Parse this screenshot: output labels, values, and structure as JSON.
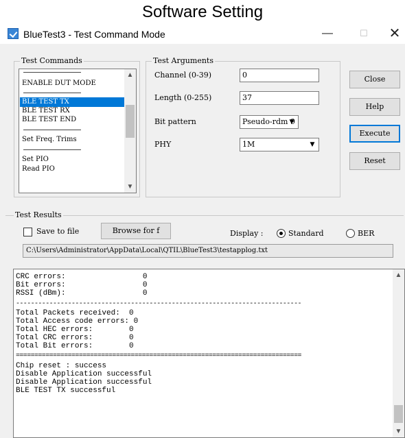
{
  "caption": "Software Setting",
  "window": {
    "title": "BlueTest3 - Test Command Mode",
    "min_glyph": "—",
    "max_glyph": "☐",
    "close_glyph": "✕"
  },
  "test_commands": {
    "legend": "Test Commands",
    "items": [
      "ENABLE DUT MODE",
      "BLE TEST TX",
      "BLE TEST RX",
      "BLE TEST END",
      "Set Freq. Trims",
      "Set PIO",
      "Read PIO"
    ],
    "selected": "BLE TEST TX"
  },
  "test_arguments": {
    "legend": "Test Arguments",
    "channel_label": "Channel (0-39)",
    "channel_value": "0",
    "length_label": "Length (0-255)",
    "length_value": "37",
    "bit_pattern_label": "Bit pattern",
    "bit_pattern_value": "Pseudo-rdm 9",
    "phy_label": "PHY",
    "phy_value": "1M"
  },
  "buttons": {
    "close": "Close",
    "help": "Help",
    "execute": "Execute",
    "reset": "Reset"
  },
  "test_results": {
    "legend": "Test Results",
    "save_to_file_label": "Save to file",
    "save_to_file_checked": false,
    "browse_label": "Browse for f",
    "display_label": "Display :",
    "display_options": [
      "Standard",
      "BER"
    ],
    "display_selected": "Standard",
    "log_path": "C:\\Users\\Administrator\\AppData\\Local\\QTIL\\BlueTest3\\testapplog.txt"
  },
  "log_lines": [
    "CRC errors:                 0",
    "Bit errors:                 0",
    "RSSI (dBm):                 0",
    "-----------------------------------------------------------------------------",
    "Total Packets received:  0",
    "Total Access code errors: 0",
    "Total HEC errors:        0",
    "Total CRC errors:        0",
    "Total Bit errors:        0",
    "=============================================================================",
    "Chip reset : success",
    "Disable Application successful",
    "Disable Application successful",
    "BLE TEST TX successful"
  ],
  "colors": {
    "selection": "#0078d7",
    "window_bg": "#f0f0f0"
  }
}
